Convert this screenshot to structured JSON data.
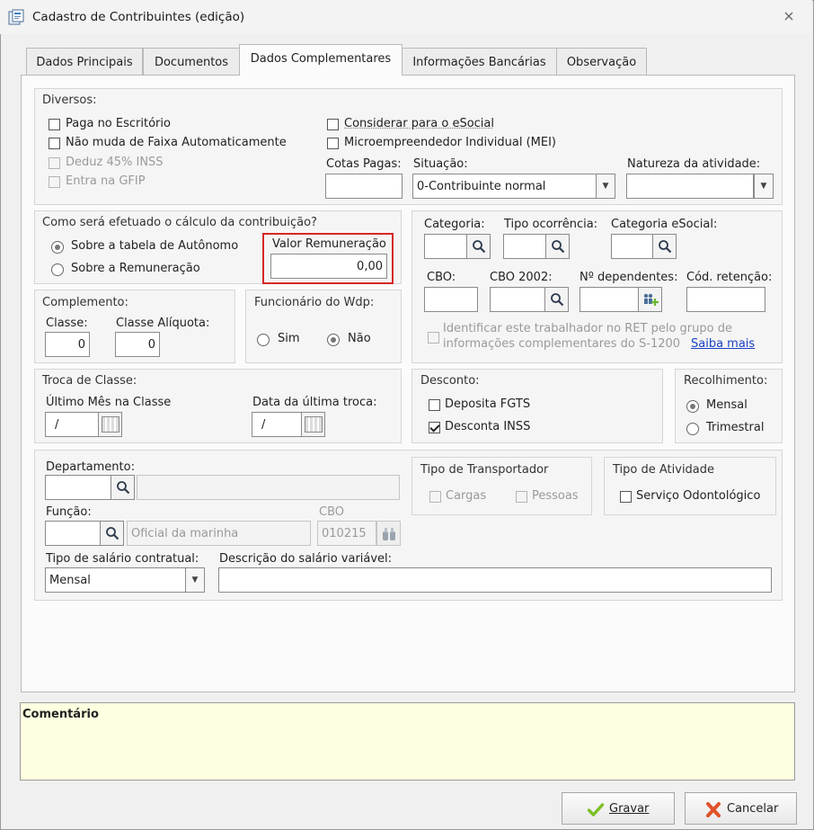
{
  "window": {
    "title": "Cadastro de Contribuintes (edição)"
  },
  "tabs": [
    "Dados Principais",
    "Documentos",
    "Dados Complementares",
    "Informações Bancárias",
    "Observação"
  ],
  "diversos": {
    "title": "Diversos:",
    "paga_escritorio": "Paga no Escritório",
    "nao_muda_faixa": "Não muda de Faixa Automaticamente",
    "deduz_inss": "Deduz 45% INSS",
    "entra_gfip": "Entra na GFIP",
    "considerar_esocial": "Considerar para o eSocial",
    "mei": "Microempreendedor Individual (MEI)",
    "cotas_label": "Cotas Pagas:",
    "cotas_value": "",
    "situacao_label": "Situação:",
    "situacao_value": "0-Contribuinte normal",
    "natureza_label": "Natureza da atividade:",
    "natureza_value": ""
  },
  "calculo": {
    "title": "Como será efetuado o cálculo da contribuição?",
    "opt_tabela": "Sobre a tabela de Autônomo",
    "opt_remuneracao": "Sobre a Remuneração",
    "valor_label": "Valor Remuneração",
    "valor_value": "0,00"
  },
  "categoria": {
    "categoria_label": "Categoria:",
    "tipo_ocorrencia_label": "Tipo ocorrência:",
    "categoria_esocial_label": "Categoria eSocial:",
    "cbo_label": "CBO:",
    "cbo2002_label": "CBO 2002:",
    "dependentes_label": "Nº dependentes:",
    "cod_retencao_label": "Cód. retenção:",
    "ret_text_1": "Identificar este trabalhador no RET pelo grupo de",
    "ret_text_2": "informações complementares do S-1200",
    "saiba_mais": "Saiba mais"
  },
  "complemento": {
    "title": "Complemento:",
    "classe_label": "Classe:",
    "classe_value": "0",
    "aliquota_label": "Classe Alíquota:",
    "aliquota_value": "0"
  },
  "funcionario": {
    "title": "Funcionário do Wdp:",
    "sim": "Sim",
    "nao": "Não"
  },
  "troca": {
    "title": "Troca de Classe:",
    "ultimo_label": "Último Mês na Classe",
    "ultimo_value": "/",
    "data_label": "Data da última troca:",
    "data_value": "/"
  },
  "desconto": {
    "title": "Desconto:",
    "fgts": "Deposita FGTS",
    "inss": "Desconta INSS"
  },
  "recolhimento": {
    "title": "Recolhimento:",
    "mensal": "Mensal",
    "trimestral": "Trimestral"
  },
  "depto": {
    "departamento_label": "Departamento:",
    "funcao_label": "Função:",
    "funcao_desc": "Oficial da marinha",
    "cbo_label": "CBO",
    "cbo_value": "010215",
    "tipo_salario_label": "Tipo de salário contratual:",
    "tipo_salario_value": "Mensal",
    "descricao_label": "Descrição do salário variável:",
    "descricao_value": ""
  },
  "transportador": {
    "title": "Tipo de Transportador",
    "cargas": "Cargas",
    "pessoas": "Pessoas"
  },
  "atividade": {
    "title": "Tipo de Atividade",
    "odonto": "Serviço Odontológico"
  },
  "comentario": {
    "label": "Comentário"
  },
  "buttons": {
    "gravar": "Gravar",
    "cancelar": "Cancelar"
  },
  "colors": {
    "highlight": "#d62828",
    "comment_bg": "#ffffe1",
    "link": "#1a40c4"
  }
}
